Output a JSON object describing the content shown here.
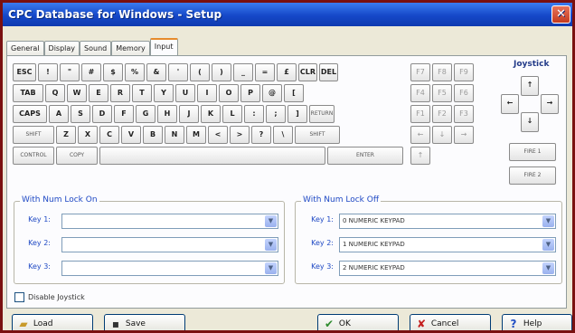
{
  "window": {
    "title": "CPC Database for Windows - Setup",
    "close_symbol": "✕"
  },
  "tabs": [
    {
      "label": "General",
      "active": false
    },
    {
      "label": "Display",
      "active": false
    },
    {
      "label": "Sound",
      "active": false
    },
    {
      "label": "Memory",
      "active": false
    },
    {
      "label": "Input",
      "active": true
    }
  ],
  "keyboard": {
    "row1": [
      "ESC",
      "!",
      "\"",
      "#",
      "$",
      "%",
      "&",
      "'",
      "(",
      ")",
      "_",
      "=",
      "£",
      "CLR",
      "DEL"
    ],
    "row2": [
      "TAB",
      "Q",
      "W",
      "E",
      "R",
      "T",
      "Y",
      "U",
      "I",
      "O",
      "P",
      "@",
      "["
    ],
    "row3": [
      "CAPS",
      "A",
      "S",
      "D",
      "F",
      "G",
      "H",
      "J",
      "K",
      "L",
      ":",
      ";",
      "]",
      "RETURN"
    ],
    "row4": [
      "SHIFT",
      "Z",
      "X",
      "C",
      "V",
      "B",
      "N",
      "M",
      "<",
      ">",
      "?",
      "\\",
      "SHIFT"
    ],
    "row5": [
      "CONTROL",
      "COPY",
      "",
      "ENTER"
    ],
    "numpad": [
      "F7",
      "F8",
      "F9",
      "F4",
      "F5",
      "F6",
      "F1",
      "F2",
      "F3",
      "←",
      "↓",
      "→"
    ],
    "up_key": "↑"
  },
  "joystick": {
    "label": "Joystick",
    "up": "↑",
    "down": "↓",
    "left": "←",
    "right": "→",
    "fire1": "FIRE 1",
    "fire2": "FIRE 2"
  },
  "numlock_on": {
    "title": "With Num Lock On",
    "rows": [
      {
        "label": "Key 1:",
        "value": ""
      },
      {
        "label": "Key 2:",
        "value": ""
      },
      {
        "label": "Key 3:",
        "value": ""
      }
    ]
  },
  "numlock_off": {
    "title": "With Num Lock Off",
    "rows": [
      {
        "label": "Key 1:",
        "value": "0 NUMERIC KEYPAD"
      },
      {
        "label": "Key 2:",
        "value": "1 NUMERIC KEYPAD"
      },
      {
        "label": "Key 3:",
        "value": "2 NUMERIC KEYPAD"
      }
    ]
  },
  "disable_joystick": {
    "label": "Disable Joystick",
    "checked": false
  },
  "buttons": {
    "load": "Load",
    "save": "Save",
    "ok": "OK",
    "cancel": "Cancel",
    "help": "Help"
  },
  "icons": {
    "load": "open-folder-icon",
    "save": "floppy-disk-icon",
    "ok": "checkmark-icon",
    "cancel": "red-x-icon",
    "help": "help-question-icon"
  },
  "colors": {
    "titlebar": "#1548c8",
    "frame": "#7a1010",
    "ok_check": "#2e8b2e",
    "cancel_x": "#c41e1e",
    "help": "#1f4ec4",
    "active_tab_accent": "#e68b2c"
  }
}
